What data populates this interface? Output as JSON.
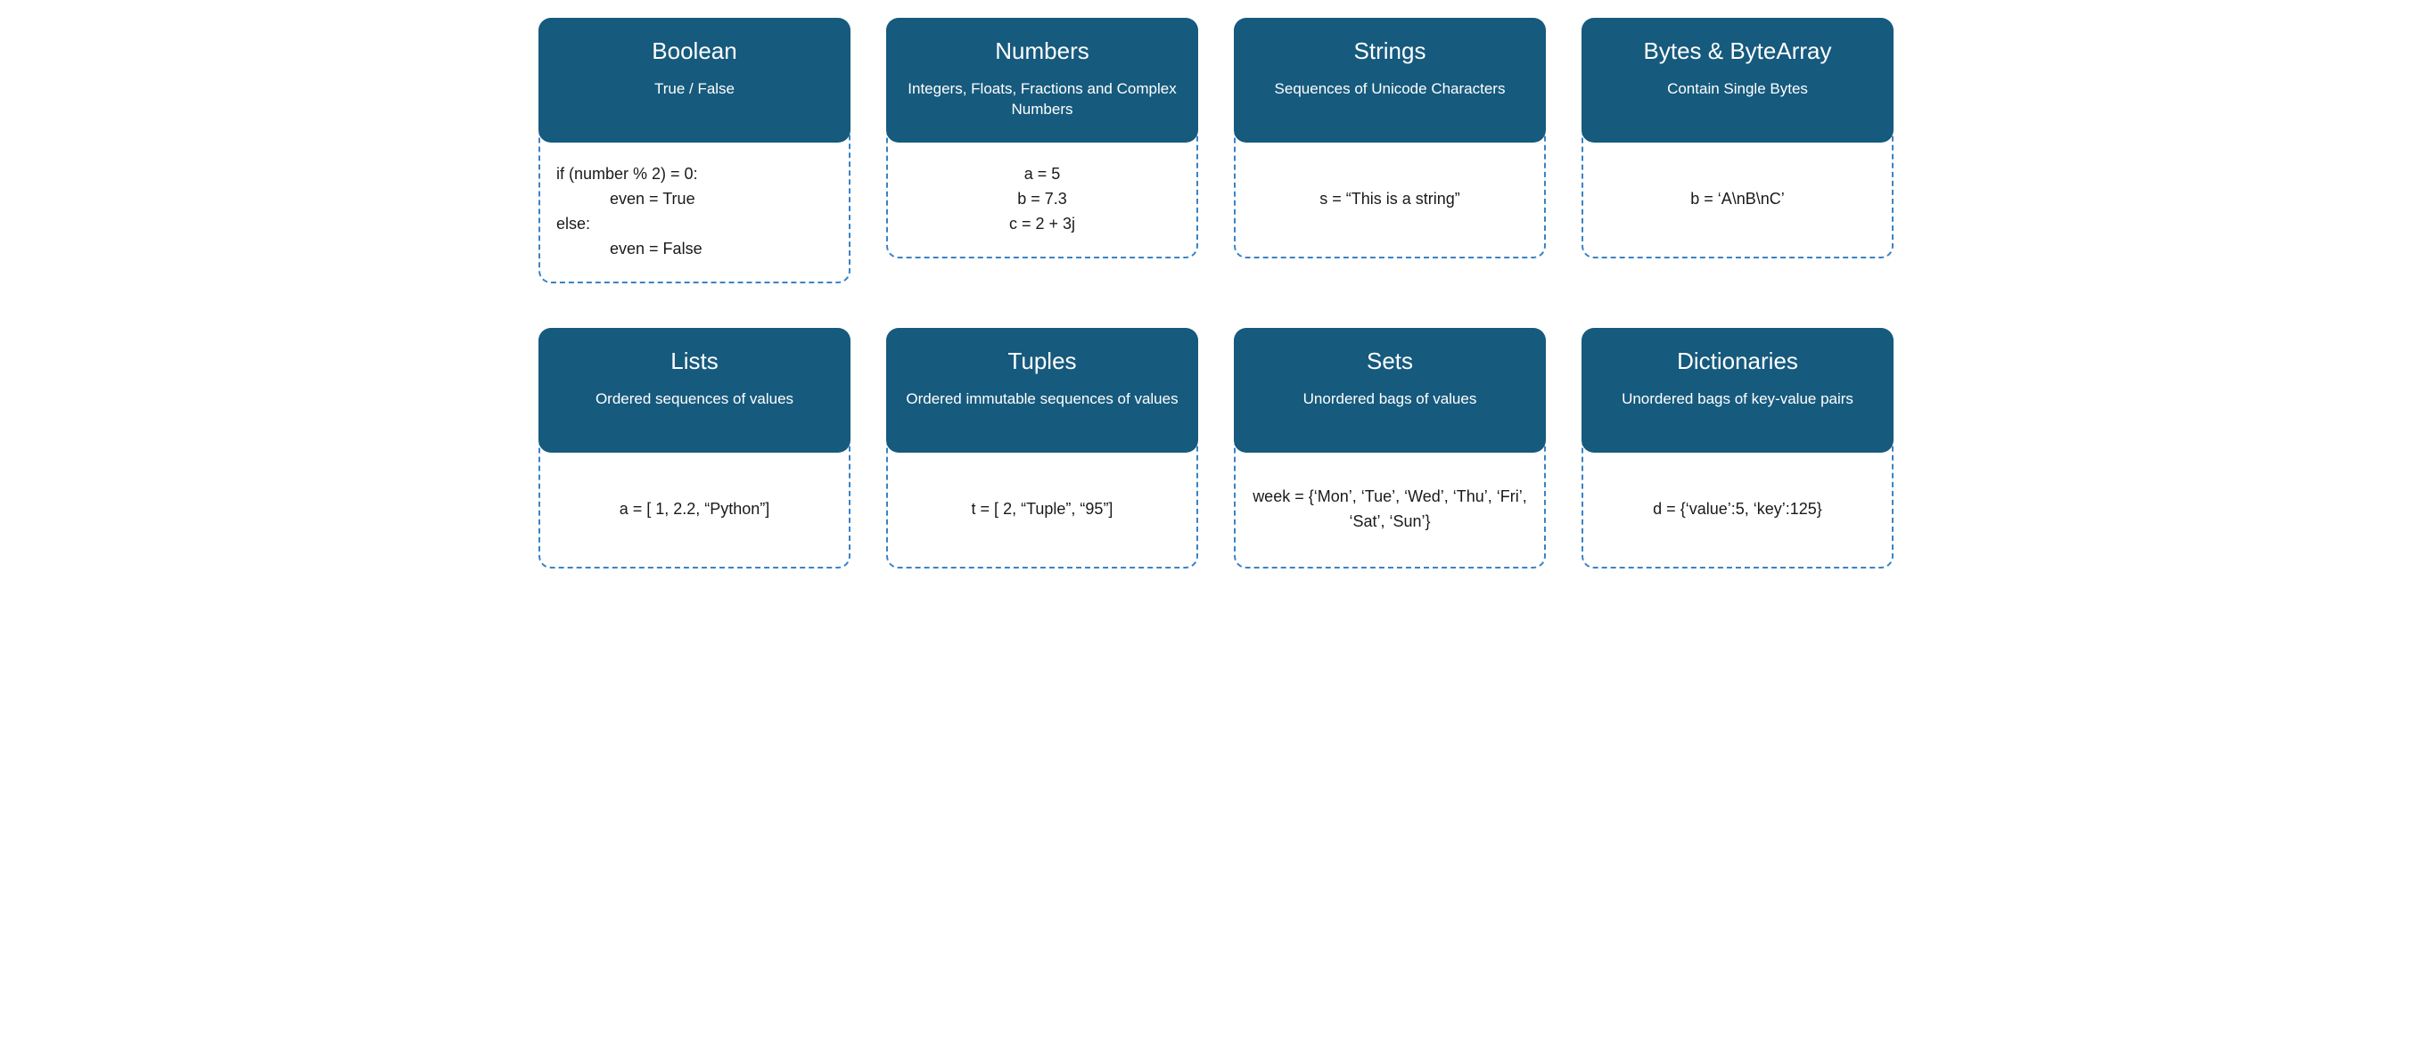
{
  "cards": [
    {
      "title": "Boolean",
      "subtitle": "True / False",
      "bodyAlign": "left",
      "lines": [
        "if (number % 2) = 0:",
        "            even = True",
        "else:",
        "            even = False"
      ]
    },
    {
      "title": "Numbers",
      "subtitle": "Integers, Floats, Fractions and Complex Numbers",
      "bodyAlign": "centered",
      "lines": [
        "a = 5",
        "b = 7.3",
        "c = 2 + 3j"
      ]
    },
    {
      "title": "Strings",
      "subtitle": "Sequences of Unicode Characters",
      "bodyAlign": "centered",
      "lines": [
        "s = “This is a string”"
      ]
    },
    {
      "title": "Bytes & ByteArray",
      "subtitle": "Contain Single Bytes",
      "bodyAlign": "centered",
      "lines": [
        "b = ‘A\\nB\\nC’"
      ]
    },
    {
      "title": "Lists",
      "subtitle": "Ordered sequences of values",
      "bodyAlign": "centered",
      "lines": [
        "a = [ 1, 2.2, “Python”]"
      ]
    },
    {
      "title": "Tuples",
      "subtitle": "Ordered immutable sequences of values",
      "bodyAlign": "centered",
      "lines": [
        "t = [ 2, “Tuple”, “95”]"
      ]
    },
    {
      "title": "Sets",
      "subtitle": "Unordered bags of values",
      "bodyAlign": "centered",
      "lines": [
        "week = {‘Mon’, ‘Tue’, ‘Wed’, ‘Thu’, ‘Fri’, ‘Sat’, ‘Sun’}"
      ]
    },
    {
      "title": "Dictionaries",
      "subtitle": "Unordered bags of key-value pairs",
      "bodyAlign": "centered",
      "lines": [
        "d = {‘value’:5, ‘key’:125}"
      ]
    }
  ]
}
